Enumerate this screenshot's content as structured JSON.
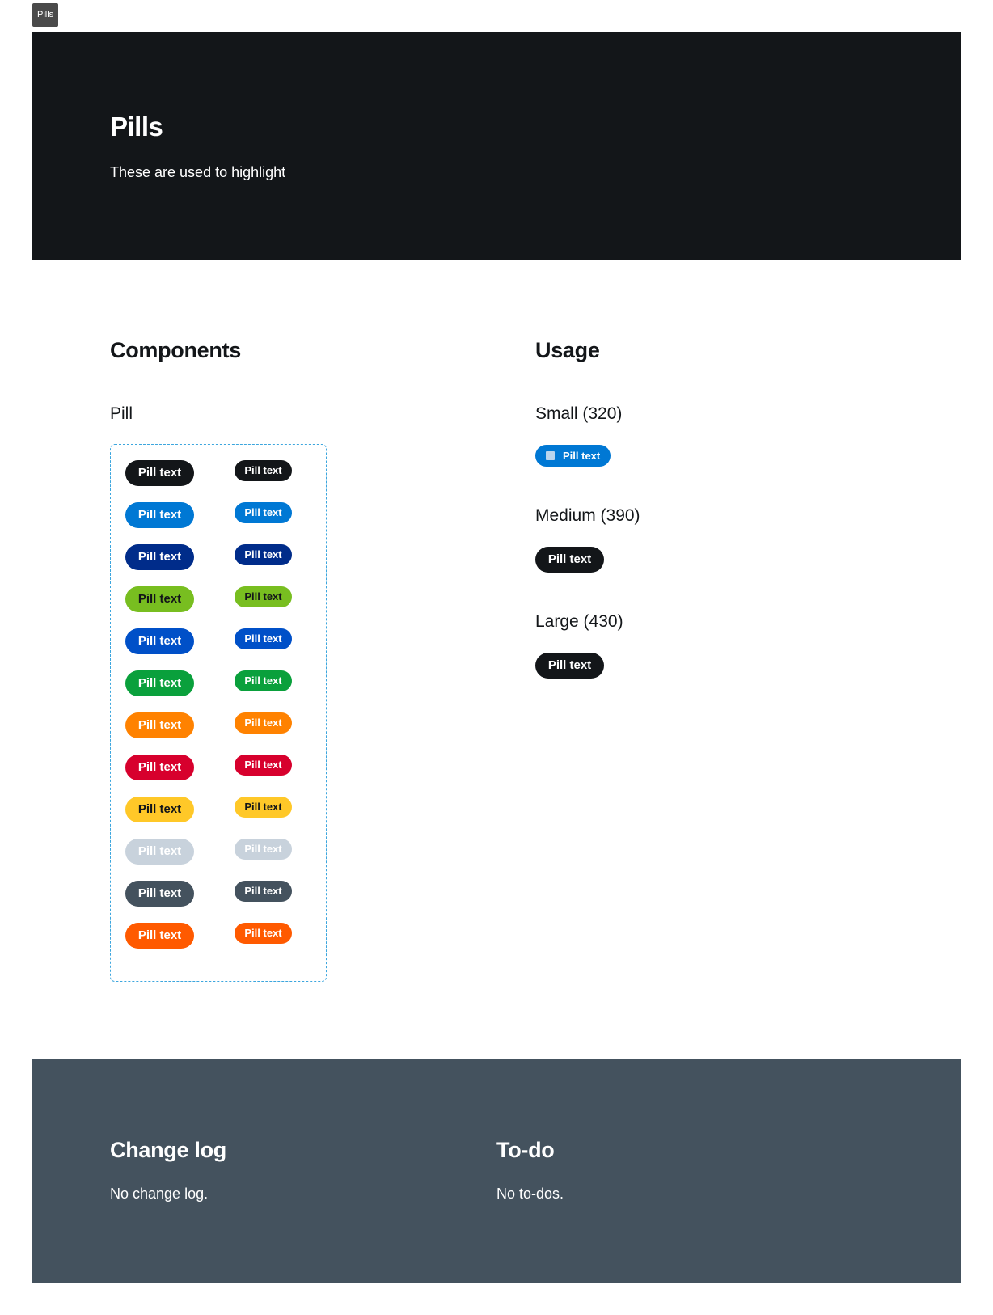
{
  "frame_tag": "Pills",
  "hero": {
    "title": "Pills",
    "subtitle": "These are used to highlight"
  },
  "components": {
    "heading": "Components",
    "subheading": "Pill"
  },
  "usage": {
    "heading": "Usage",
    "small_label": "Small (320)",
    "medium_label": "Medium (390)",
    "large_label": "Large (430)",
    "pill_text": "Pill text",
    "small_icon": "square-icon"
  },
  "pill_label": "Pill text",
  "pill_variants": [
    {
      "bg": "#131619",
      "fg": "#ffffff"
    },
    {
      "bg": "#0078d4",
      "fg": "#ffffff"
    },
    {
      "bg": "#002c8a",
      "fg": "#ffffff"
    },
    {
      "bg": "#78be20",
      "fg": "#131619"
    },
    {
      "bg": "#0050c8",
      "fg": "#ffffff"
    },
    {
      "bg": "#0aa03c",
      "fg": "#ffffff"
    },
    {
      "bg": "#ff8200",
      "fg": "#ffffff"
    },
    {
      "bg": "#d7002d",
      "fg": "#ffffff"
    },
    {
      "bg": "#ffc828",
      "fg": "#131619"
    },
    {
      "bg": "#c8d2dc",
      "fg": "#ffffff"
    },
    {
      "bg": "#44525e",
      "fg": "#ffffff"
    },
    {
      "bg": "#ff5a00",
      "fg": "#ffffff"
    }
  ],
  "footer": {
    "changelog_heading": "Change log",
    "changelog_text": "No change log.",
    "todo_heading": "To-do",
    "todo_text": "No to-dos."
  }
}
